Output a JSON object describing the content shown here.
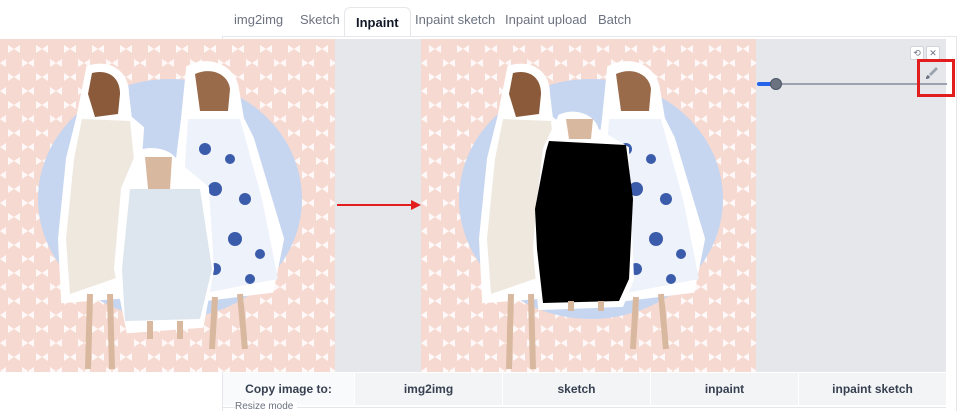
{
  "tabs": [
    {
      "label": "img2img",
      "active": false
    },
    {
      "label": "Sketch",
      "active": false
    },
    {
      "label": "Inpaint",
      "active": true
    },
    {
      "label": "Inpaint sketch",
      "active": false
    },
    {
      "label": "Inpaint upload",
      "active": false
    },
    {
      "label": "Batch",
      "active": false
    }
  ],
  "canvas": {
    "controls": {
      "undo_icon": "undo-icon",
      "close_icon": "close-icon",
      "brush_icon": "brush-icon"
    },
    "brush_size_level": 0.08,
    "highlight_color": "#e11d1d",
    "arrow_color": "#e11d1d",
    "background_color": "#f6d9d0",
    "circle_color": "#c7d6f0"
  },
  "copy_image": {
    "label": "Copy image to:",
    "targets": [
      "img2img",
      "sketch",
      "inpaint",
      "inpaint sketch"
    ]
  },
  "resize_mode": {
    "label": "Resize mode"
  }
}
